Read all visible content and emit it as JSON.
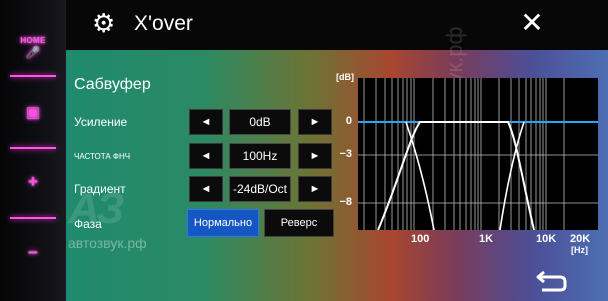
{
  "bezel": {
    "home_label": "HOME",
    "mic_icon": "microphone-icon",
    "display_icon": "display-icon",
    "volume_up": "+",
    "volume_down": "−"
  },
  "header": {
    "title": "X'over",
    "settings_icon": "gear-icon",
    "close_icon": "close-icon"
  },
  "section": {
    "title": "Сабвуфер",
    "rows": [
      {
        "label": "Усиление",
        "value": "0dB"
      },
      {
        "label": "ЧАСТОТА ФНЧ",
        "value": "100Hz"
      },
      {
        "label": "Градиент",
        "value": "-24dB/Oct"
      }
    ],
    "phase": {
      "label": "Фаза",
      "options": [
        "Нормально",
        "Реверс"
      ],
      "selected": "Нормально"
    },
    "left_arrow": "◄",
    "right_arrow": "►"
  },
  "graph": {
    "y_unit": "[dB]",
    "y_ticks": [
      "0",
      "−3",
      "−8"
    ],
    "x_ticks": [
      "100",
      "1K",
      "10K",
      "20K"
    ],
    "x_unit": "[Hz]"
  },
  "watermark": {
    "logo": "АЗ",
    "site": "автозвук.рф",
    "vertical": "автозвук.рф"
  },
  "footer": {
    "back_icon": "back-arrow-icon"
  },
  "colors": {
    "accent_blue": "#1556c2",
    "bezel_pink": "#ff52ea",
    "curve_white": "#ffffff"
  }
}
